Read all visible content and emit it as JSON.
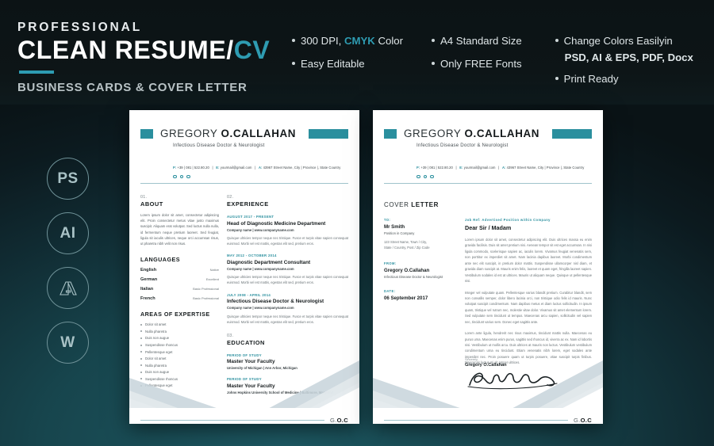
{
  "header": {
    "eyebrow": "PROFESSIONAL",
    "title_main": "CLEAN RESUME/",
    "title_accent": "CV",
    "subtitle": "BUSINESS CARDS & COVER LETTER"
  },
  "features": {
    "col1": [
      {
        "pre": "300 DPI, ",
        "hl": "CMYK",
        "post": " Color"
      },
      {
        "pre": "Easy Editable",
        "hl": "",
        "post": ""
      }
    ],
    "col2": [
      {
        "pre": "A4 Standard Size",
        "hl": "",
        "post": ""
      },
      {
        "pre": "Only FREE Fonts",
        "hl": "",
        "post": ""
      }
    ],
    "col3_line1": "Change Colors Easilyin",
    "col3_formats": "PSD, AI & EPS, PDF, Docx",
    "col3_line3": "Print Ready"
  },
  "badges": [
    {
      "name": "photoshop-badge",
      "label": "PS"
    },
    {
      "name": "illustrator-badge",
      "label": "AI"
    },
    {
      "name": "adobe-badge",
      "label": "A"
    },
    {
      "name": "word-badge",
      "label": "W"
    }
  ],
  "resume": {
    "first_name": "GREGORY ",
    "last_name": "O.CALLAHAN",
    "role": "Infectious Disease Doctor & Neurologist",
    "contact_phone": "P: +39 | 081 | 522.80.20",
    "contact_email": "E: yourmail@gmail.com",
    "contact_address": "A: 43967 Street Name, City | Province |, State Country",
    "about": {
      "num": "01.",
      "title": "ABOUT",
      "text": "Lorem ipsum dolor sit amet, consectetur adipiscing elit. Proin consectetur metus vitae justo maximus suscipit. Aliquam erat volutpat. Sed luctus nulla nulla, id fermentum neque pretium laoreet. Sed feugiat, ligula sit iaculis ultrices, neque orci accumsan risus, ut pharetra nibh velit non risus."
    },
    "languages": {
      "title": "LANGUAGES",
      "rows": [
        {
          "name": "English",
          "level": "Native"
        },
        {
          "name": "German",
          "level": "Excellent"
        },
        {
          "name": "Italian",
          "level": "Basic Professional"
        },
        {
          "name": "French",
          "level": "Basic Professional"
        }
      ]
    },
    "expertise": {
      "title": "AREAS OF EXPERTISE",
      "items": [
        "Dolor sit amet",
        "Nulla pharetra",
        "Duis non augue",
        "Suspendisse rhoncus",
        "Pellentesque eget",
        "Dolor sit amet",
        "Nulla pharetra",
        "Duis non augue",
        "Suspendisse rhoncus",
        "Pellentesque eget"
      ]
    },
    "experience": {
      "num": "02.",
      "title": "EXPERIENCE",
      "entries": [
        {
          "date": "AUGUST 2017 - PRESENT",
          "job": "Head of Diagnostic Medicine Department",
          "company": "Company name | www.companyname.com",
          "text": "Quisque ultricies tempor neque nec tristique. Fusce et turpis vitae sapien consequat euismod. Morbi vel est mattis, egestas elit sed, pretium eros."
        },
        {
          "date": "MAY 2012 - OCTOBER 2014",
          "job": "Diagnostic Department Consultant",
          "company": "Company name | www.companyname.com",
          "text": "Quisque ultricies tempor neque nec tristique. Fusce et turpis vitae sapien consequat euismod. Morbi vel est mattis, egestas elit sed, pretium eros."
        },
        {
          "date": "JULY 2008 - APRIL 2014",
          "job": "Infectious Disease Doctor & Neurologist",
          "company": "Company name | www.companyname.com",
          "text": "Quisque ultricies tempor neque nec tristique. Fusce et turpis vitae sapien consequat euismod. Morbi vel est mattis, egestas elit sed, pretium eros."
        }
      ]
    },
    "education": {
      "num": "03.",
      "title": "EDUCATION",
      "entries": [
        {
          "period": "PERIOD OF STUDY",
          "degree": "Master Your Faculty",
          "school": "University of Michigan | Ann Arbor, Michigan"
        },
        {
          "period": "PERIOD OF STUDY",
          "degree": "Master Your Faculty",
          "school": "Johns Hopkins University School of Medicine | Baltimore, Maryland"
        }
      ]
    },
    "footer_logo_pre": "G.",
    "footer_logo_bold": "O.C"
  },
  "cover": {
    "title_light": "COVER ",
    "title_bold": "LETTER",
    "to_label": "TO:",
    "to_name": "Mr Smith",
    "to_position": "Position in Company",
    "to_address": "123 Street Name, Town / City,\nState / Country, Post / Zip Code",
    "from_label": "FROM:",
    "from_name": "Gregory O.Callahan",
    "from_role": "Infectious Disease Doctor & Neurologist",
    "date_label": "DATE:",
    "date_value": "06 September 2017",
    "job_ref": "Job Ref: Advertised Position within Company",
    "salutation": "Dear Sir / Madam",
    "paragraph1": "Lorem ipsum dolor sit amet, consectetur adipiscing elit. Duis ultrices massa eu enim gravida facilisis. Duis sit amet pretium nisi. Aenean tempor sit est eget accumsan. In nisi ligula commodo, scelerisque sapien ac, iaculis lorem. Vivamus feugiat venenatis sem, non porttitor ex imperdiet sit amet. Nam lacinia dapibus laoreet. Morbi condimentum ante nec elit suscipit, in pretium dolor mattis. Suspendisse ullamcorper nisl diam, et gravida diam suscipit at. Mauris enim felis, laoreet et quam eget, fringilla laoreet sapien. Vestibulum sodales id est at ultrices. Mauris ut aliquam neque. Quisque ut pellentesque nisi.",
    "paragraph2": "Integer vel vulputate quam. Pellentesque varius blandit pretium. Curabitur blandit, sem non convallis semper, dolor libero lacinia orci, non tristique odio felis id mauris. Nunc volutpat suscipit condimentum. Nam dapibus metus et diam luctus sollicitudin. In ipsum quam, tristique vel rutrum nec, molestie vitae dolor. Vivamus sit amet elementum lorem. Sed vulputate sem tincidunt ut tempus. Maecenas arcu sapien, sollicitudin vel sapien nec, tincidunt varius sem. Donec eget sagittis ante.",
    "paragraph3": "Lorem ante ligula, hendrerit nec risus maximus, tincidunt mattis nulla. Maecenas eu purus urna. Maecenas enim purus, sagittis sed rhoncus id, viverra ac ex. Nam id lobortis nisi. Vestibulum ut mollis arcu. Duis ultrices at mauris non luctus. Vestibulum vestibulum condimentum urna eu tincidunt. Etiam venenatis nibh lorem, eget sodales ante imperdiet nec. Proin posuere quam ut turpis posuere, vitae suscipit turpis finibus. Maecenas luctus mi sit amper ultrices.",
    "sincerely": "Sincerely,",
    "sign_name": "Gregory O.Callahan",
    "footer_logo_pre": "G.",
    "footer_logo_bold": "O.C"
  },
  "colors": {
    "accent": "#2a8f9e",
    "accent_bright": "#2e9cb2",
    "bg_top": "#0d1416",
    "bg_teal": "#16444d",
    "paper": "#ffffff"
  }
}
